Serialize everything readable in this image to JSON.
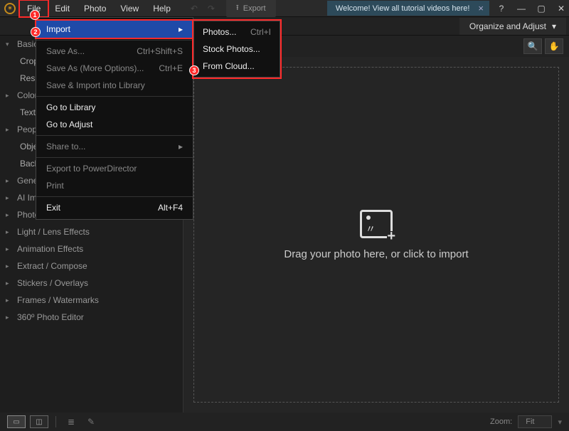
{
  "titlebar": {
    "menus": [
      "File",
      "Edit",
      "Photo",
      "View",
      "Help"
    ],
    "export": "Export",
    "welcome": "Welcome! View all tutorial videos here!"
  },
  "mode_button": "Organize and Adjust",
  "sidebar": {
    "items": [
      {
        "label": "Basic",
        "kind": "parent",
        "caret": "▾"
      },
      {
        "label": "Crop",
        "kind": "child"
      },
      {
        "label": "Resiz",
        "kind": "child"
      },
      {
        "label": "Color",
        "kind": "parent",
        "caret": "▸"
      },
      {
        "label": "Text &",
        "kind": "child"
      },
      {
        "label": "Peopl",
        "kind": "parent",
        "caret": "▸"
      },
      {
        "label": "Objec",
        "kind": "child"
      },
      {
        "label": "Backg",
        "kind": "child"
      },
      {
        "label": "Gene",
        "kind": "parent",
        "caret": "▸"
      },
      {
        "label": "AI Improvements",
        "kind": "parent",
        "caret": "▸"
      },
      {
        "label": "Photo Effects",
        "kind": "parent",
        "caret": "▸"
      },
      {
        "label": "Light / Lens Effects",
        "kind": "parent",
        "caret": "▸"
      },
      {
        "label": "Animation Effects",
        "kind": "parent",
        "caret": "▸"
      },
      {
        "label": "Extract / Compose",
        "kind": "parent",
        "caret": "▸"
      },
      {
        "label": "Stickers / Overlays",
        "kind": "parent",
        "caret": "▸"
      },
      {
        "label": "Frames / Watermarks",
        "kind": "parent",
        "caret": "▸"
      },
      {
        "label": "360º Photo Editor",
        "kind": "parent",
        "caret": "▸"
      }
    ]
  },
  "file_menu": [
    {
      "label": "Import",
      "shortcut": "▸",
      "enabled": true,
      "highlight": true
    },
    {
      "sep": true
    },
    {
      "label": "Save As...",
      "shortcut": "Ctrl+Shift+S",
      "enabled": false
    },
    {
      "label": "Save As (More Options)...",
      "shortcut": "Ctrl+E",
      "enabled": false
    },
    {
      "label": "Save & Import into Library",
      "shortcut": "",
      "enabled": false
    },
    {
      "sep": true
    },
    {
      "label": "Go to Library",
      "shortcut": "",
      "enabled": true
    },
    {
      "label": "Go to Adjust",
      "shortcut": "",
      "enabled": true
    },
    {
      "sep": true
    },
    {
      "label": "Share to...",
      "shortcut": "▸",
      "enabled": false
    },
    {
      "sep": true
    },
    {
      "label": "Export to PowerDirector",
      "shortcut": "",
      "enabled": false
    },
    {
      "label": "Print",
      "shortcut": "",
      "enabled": false
    },
    {
      "sep": true
    },
    {
      "label": "Exit",
      "shortcut": "Alt+F4",
      "enabled": true
    }
  ],
  "import_submenu": [
    {
      "label": "Photos...",
      "shortcut": "Ctrl+I"
    },
    {
      "label": "Stock Photos...",
      "shortcut": ""
    },
    {
      "label": "From Cloud...",
      "shortcut": ""
    }
  ],
  "drop_text": "Drag your photo here, or click to import",
  "bottom": {
    "zoom_label": "Zoom:",
    "zoom_value": "Fit"
  }
}
